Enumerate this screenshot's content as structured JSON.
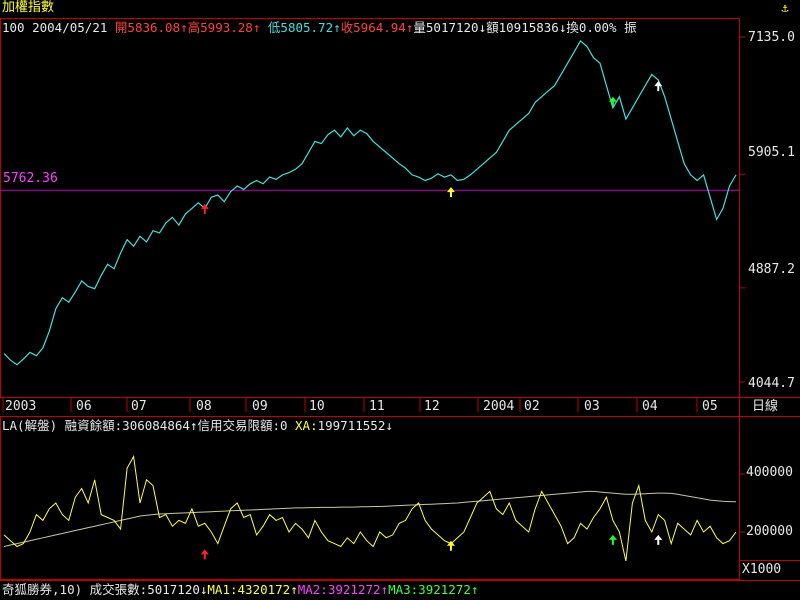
{
  "header": {
    "title": "加權指數",
    "code": "100",
    "date": "2004/05/21",
    "open_label": "開",
    "open": "5836.08",
    "open_arrow": "↑",
    "high_label": "高",
    "high": "5993.28",
    "high_arrow": "↑",
    "low_label": "低",
    "low": "5805.72",
    "low_arrow": "↑",
    "close_label": "收",
    "close": "5964.94",
    "close_arrow": "↑",
    "volume_label": "量",
    "volume": "5017120",
    "volume_arrow": "↓",
    "amount_label": "額",
    "amount": "10915836",
    "amount_arrow": "↓",
    "turnover_label": "換",
    "turnover": "0.00%",
    "amplitude_label": "振"
  },
  "price_axis": {
    "ticks": [
      "7135.0",
      "5905.1",
      "4887.2",
      "4044.7"
    ]
  },
  "reference_line": {
    "label": "5762.36",
    "value": 5762.36
  },
  "time_axis": {
    "labels": [
      "2003",
      "06",
      "07",
      "08",
      "09",
      "10",
      "11",
      "12",
      "2004",
      "02",
      "03",
      "04",
      "05"
    ],
    "period": "日線"
  },
  "lower_info": {
    "indicator": "LA(解盤)",
    "margin_label": "融資餘額:",
    "margin_value": "306084864",
    "margin_arrow": "↑",
    "credit_label": "信用交易限額:",
    "credit_value": "0",
    "xa_label": "XA:",
    "xa_value": "199711552",
    "xa_arrow": "↓"
  },
  "lower_axis": {
    "ticks": [
      "400000",
      "200000"
    ],
    "unit": "X1000"
  },
  "footer": {
    "source": "奇狐勝券",
    "param": ",10)",
    "vol_label": "成交張數:",
    "vol_value": "5017120",
    "vol_arrow": "↓",
    "ma1_label": "MA1:",
    "ma1_value": "4320172",
    "ma1_arrow": "↑",
    "ma2_label": "MA2:",
    "ma2_value": "3921272",
    "ma2_arrow": "↑",
    "ma3_label": "MA3:",
    "ma3_value": "3921272",
    "ma3_arrow": "↑"
  },
  "colors": {
    "background": "#000000",
    "frame": "#c00000",
    "price_line": "#40e0e0",
    "reference_line": "#c000c0",
    "lower_line": "#ffff40",
    "xa_line": "#c8c8a0",
    "up_text": "#ff4040",
    "white_text": "#e8e8e8",
    "cyan_text": "#40e0e0",
    "yellow_text": "#ffff40",
    "magenta_text": "#ff40ff",
    "green_text": "#40ff40",
    "marker_red": "#ff2020",
    "marker_yellow": "#ffff20",
    "marker_green": "#20ff20",
    "marker_white": "#ffffff"
  },
  "chart_data": [
    {
      "type": "line",
      "series": [
        {
          "values": [
            4300,
            4240,
            4200,
            4250,
            4310,
            4280,
            4350,
            4500,
            4700,
            4800,
            4760,
            4850,
            4950,
            4900,
            4880,
            5000,
            5100,
            5060,
            5200,
            5320,
            5260,
            5350,
            5300,
            5400,
            5380,
            5470,
            5520,
            5450,
            5550,
            5600,
            5650,
            5600,
            5700,
            5720,
            5660,
            5750,
            5800,
            5770,
            5820,
            5850,
            5820,
            5880,
            5860,
            5900,
            5920,
            5950,
            6000,
            6100,
            6200,
            6180,
            6260,
            6300,
            6240,
            6320,
            6250,
            6300,
            6270,
            6200,
            6150,
            6100,
            6050,
            6000,
            5960,
            5900,
            5880,
            5850,
            5870,
            5910,
            5880,
            5900,
            5850,
            5860,
            5900,
            5950,
            6000,
            6050,
            6100,
            6200,
            6300,
            6350,
            6400,
            6450,
            6550,
            6600,
            6650,
            6700,
            6800,
            6900,
            7000,
            7100,
            7050,
            6950,
            6900,
            6700,
            6500,
            6600,
            6400,
            6500,
            6600,
            6700,
            6800,
            6750,
            6600,
            6400,
            6200,
            6000,
            5900,
            5850,
            5900,
            5700,
            5500,
            5600,
            5800,
            5900
          ],
          "color": "#40e0e0"
        }
      ],
      "ylim": [
        4044.7,
        7135.0
      ],
      "yticks": [
        7135.0,
        5905.1,
        4887.2,
        4044.7
      ],
      "reference_line": 5762.36,
      "x_labels": [
        "2003",
        "06",
        "07",
        "08",
        "09",
        "10",
        "11",
        "12",
        "2004",
        "02",
        "03",
        "04",
        "05"
      ],
      "markers": [
        {
          "x_index": 31,
          "y": 5640,
          "color": "#ff2020"
        },
        {
          "x_index": 69,
          "y": 5790,
          "color": "#ffff20"
        },
        {
          "x_index": 94,
          "y": 6600,
          "color": "#20ff20"
        },
        {
          "x_index": 101,
          "y": 6740,
          "color": "#ffffff"
        }
      ],
      "grid": false
    },
    {
      "type": "line",
      "series": [
        {
          "values": [
            190000,
            170000,
            150000,
            160000,
            200000,
            260000,
            240000,
            280000,
            300000,
            260000,
            240000,
            320000,
            350000,
            300000,
            380000,
            260000,
            250000,
            240000,
            210000,
            420000,
            460000,
            300000,
            380000,
            360000,
            250000,
            260000,
            220000,
            240000,
            230000,
            280000,
            220000,
            230000,
            200000,
            160000,
            220000,
            280000,
            300000,
            250000,
            260000,
            190000,
            220000,
            260000,
            240000,
            250000,
            200000,
            230000,
            210000,
            180000,
            240000,
            200000,
            170000,
            160000,
            150000,
            180000,
            160000,
            200000,
            170000,
            150000,
            200000,
            180000,
            190000,
            230000,
            240000,
            280000,
            300000,
            240000,
            210000,
            190000,
            170000,
            160000,
            180000,
            200000,
            250000,
            300000,
            320000,
            340000,
            280000,
            260000,
            300000,
            240000,
            220000,
            200000,
            280000,
            340000,
            300000,
            260000,
            220000,
            160000,
            180000,
            230000,
            210000,
            250000,
            280000,
            320000,
            240000,
            200000,
            100000,
            300000,
            360000,
            240000,
            200000,
            260000,
            240000,
            160000,
            230000,
            210000,
            190000,
            240000,
            200000,
            220000,
            180000,
            160000,
            170000,
            200000
          ],
          "color": "#ffff40"
        },
        {
          "name": "XA",
          "values": [
            150000,
            155000,
            160000,
            165000,
            170000,
            175000,
            180000,
            185000,
            190000,
            195000,
            200000,
            205000,
            210000,
            215000,
            220000,
            225000,
            230000,
            235000,
            240000,
            245000,
            250000,
            255000,
            258000,
            260000,
            262000,
            263000,
            264000,
            265000,
            266000,
            267000,
            268000,
            269000,
            270000,
            271000,
            272000,
            273000,
            274000,
            275000,
            276000,
            277000,
            278000,
            279000,
            280000,
            281000,
            282000,
            283000,
            283000,
            284000,
            284000,
            285000,
            285000,
            285000,
            286000,
            286000,
            286000,
            287000,
            287000,
            288000,
            288000,
            289000,
            290000,
            291000,
            292000,
            293000,
            294000,
            295000,
            296000,
            297000,
            298000,
            299000,
            300000,
            302000,
            304000,
            306000,
            308000,
            310000,
            312000,
            314000,
            316000,
            318000,
            320000,
            322000,
            324000,
            326000,
            328000,
            330000,
            332000,
            334000,
            336000,
            338000,
            340000,
            340000,
            338000,
            336000,
            334000,
            332000,
            330000,
            330000,
            331000,
            332000,
            333000,
            334000,
            334000,
            333000,
            330000,
            326000,
            322000,
            318000,
            314000,
            310000,
            308000,
            306000,
            305000,
            304000
          ],
          "color": "#c8c8a0"
        }
      ],
      "ylim": [
        80000,
        560000
      ],
      "yticks": [
        400000,
        200000
      ],
      "unit": "X1000",
      "markers": [
        {
          "x_index": 31,
          "y": 140000,
          "color": "#ff2020"
        },
        {
          "x_index": 69,
          "y": 170000,
          "color": "#ffff20"
        },
        {
          "x_index": 94,
          "y": 190000,
          "color": "#20ff20"
        },
        {
          "x_index": 101,
          "y": 190000,
          "color": "#ffffff"
        }
      ],
      "grid": false
    }
  ]
}
